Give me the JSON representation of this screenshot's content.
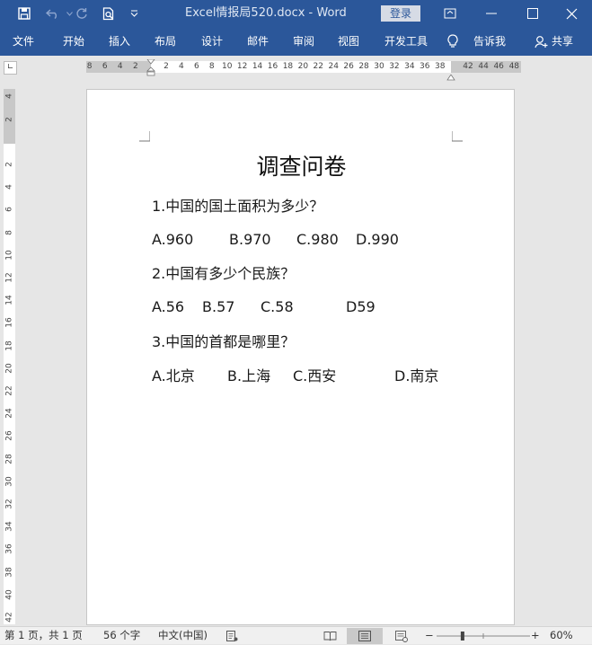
{
  "window": {
    "title": "Excel情报局520.docx  -  Word",
    "login_label": "登录"
  },
  "ribbon": {
    "tabs": [
      "文件",
      "开始",
      "插入",
      "布局",
      "设计",
      "邮件",
      "审阅",
      "视图",
      "开发工具"
    ],
    "tell_me": "告诉我",
    "share": "共享"
  },
  "ruler": {
    "left_numbers": [
      "8",
      "6",
      "4",
      "2"
    ],
    "right_numbers": [
      "2",
      "4",
      "6",
      "8",
      "10",
      "12",
      "14",
      "16",
      "18",
      "20",
      "22",
      "24",
      "26",
      "28",
      "30",
      "32",
      "34",
      "36",
      "38"
    ],
    "margin_numbers": [
      "42",
      "44",
      "46",
      "48"
    ],
    "vertical_top": [
      "4",
      "2"
    ],
    "vertical_numbers": [
      "2",
      "4",
      "6",
      "8",
      "10",
      "12",
      "14",
      "16",
      "18",
      "20",
      "22",
      "24",
      "26",
      "28",
      "30",
      "32",
      "34",
      "36",
      "38",
      "40",
      "42"
    ]
  },
  "document": {
    "title": "调查问卷",
    "questions": [
      {
        "text": "1.中国的国土面积为多少？",
        "options": [
          "A.960",
          "B.970",
          "C.980",
          "D.990"
        ]
      },
      {
        "text": "2.中国有多少个民族？",
        "options": [
          "A.56",
          "B.57",
          "C.58",
          "D59"
        ]
      },
      {
        "text": "3.中国的首都是哪里？",
        "options": [
          "A.北京",
          "B.上海",
          "C.西安",
          "D.南京"
        ]
      }
    ]
  },
  "status": {
    "page": "第 1 页，共 1 页",
    "words": "56 个字",
    "language": "中文(中国)",
    "zoom": "60%",
    "zoom_level": 0.6
  },
  "colors": {
    "accent": "#2b579a",
    "title_text": "#dfe7f3"
  },
  "icons": {
    "save": "save-icon",
    "undo": "undo-icon",
    "redo": "redo-icon",
    "print_preview": "print-preview-icon",
    "customize": "customize-qat-icon",
    "ribbon_display": "ribbon-display-icon",
    "minimize": "minimize-icon",
    "maximize": "maximize-icon",
    "close": "close-icon",
    "lightbulb": "lightbulb-icon",
    "share": "user-share-icon"
  }
}
